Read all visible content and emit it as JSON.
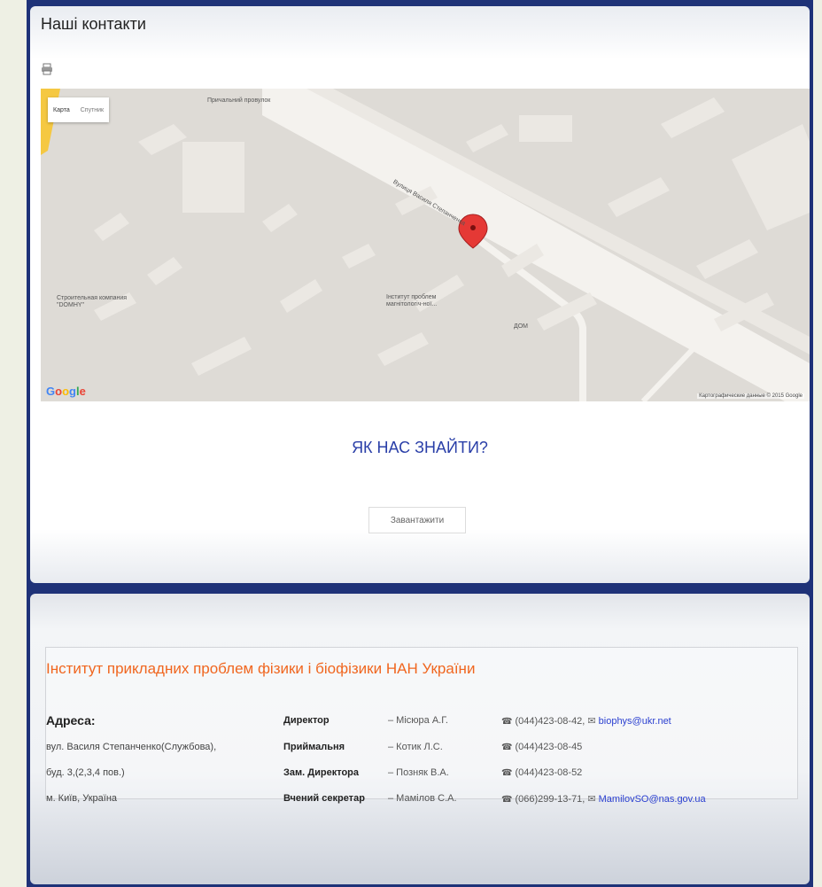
{
  "page": {
    "title": "Наші контакти"
  },
  "map": {
    "type_map": "Карта",
    "type_satellite": "Спутник",
    "street_1": "Причальний провулок",
    "street_2": "Вулиця Василя Степанченка",
    "poi_1": "Строительная компания \"DOMHY\"",
    "poi_2": "Інститут проблем магнітологіч-ної...",
    "poi_3": "ДОМ",
    "logo": "Google",
    "attribution": "Картографические данные © 2015 Google"
  },
  "find": {
    "heading": "ЯК НАС ЗНАЙТИ?"
  },
  "download": {
    "label": "Завантажити"
  },
  "footer": {
    "institute": "Інститут прикладних проблем фізики і біофізики НАН України",
    "address_label": "Адреса:",
    "address_lines": [
      "вул. Василя Степанченко(Службова),",
      "буд. 3,(2,3,4 пов.)",
      "м. Київ, Україна"
    ],
    "staff": [
      {
        "role": "Директор",
        "name": "– Мiсюра А.Г.",
        "phone": "(044)423-08-42,",
        "email": "biophys@ukr.net"
      },
      {
        "role": "Приймальня",
        "name": "– Котик Л.С.",
        "phone": "(044)423-08-45",
        "email": ""
      },
      {
        "role": "Зам. Директора",
        "name": "– Позняк В.А.",
        "phone": "(044)423-08-52",
        "email": ""
      },
      {
        "role": "Вчений секретар",
        "name": "– Мамілов С.А.",
        "phone": "(066)299-13-71,",
        "email": "MamilovSO@nas.gov.ua"
      }
    ]
  },
  "icons": {
    "phone": "phone-icon",
    "mail": "envelope-icon",
    "print": "printer-icon",
    "pin": "map-pin-icon"
  },
  "colors": {
    "frame": "#1e3278",
    "heading": "#2a3fa8",
    "institute": "#f0661f",
    "link": "#2a3fd0",
    "pin": "#e53935"
  }
}
